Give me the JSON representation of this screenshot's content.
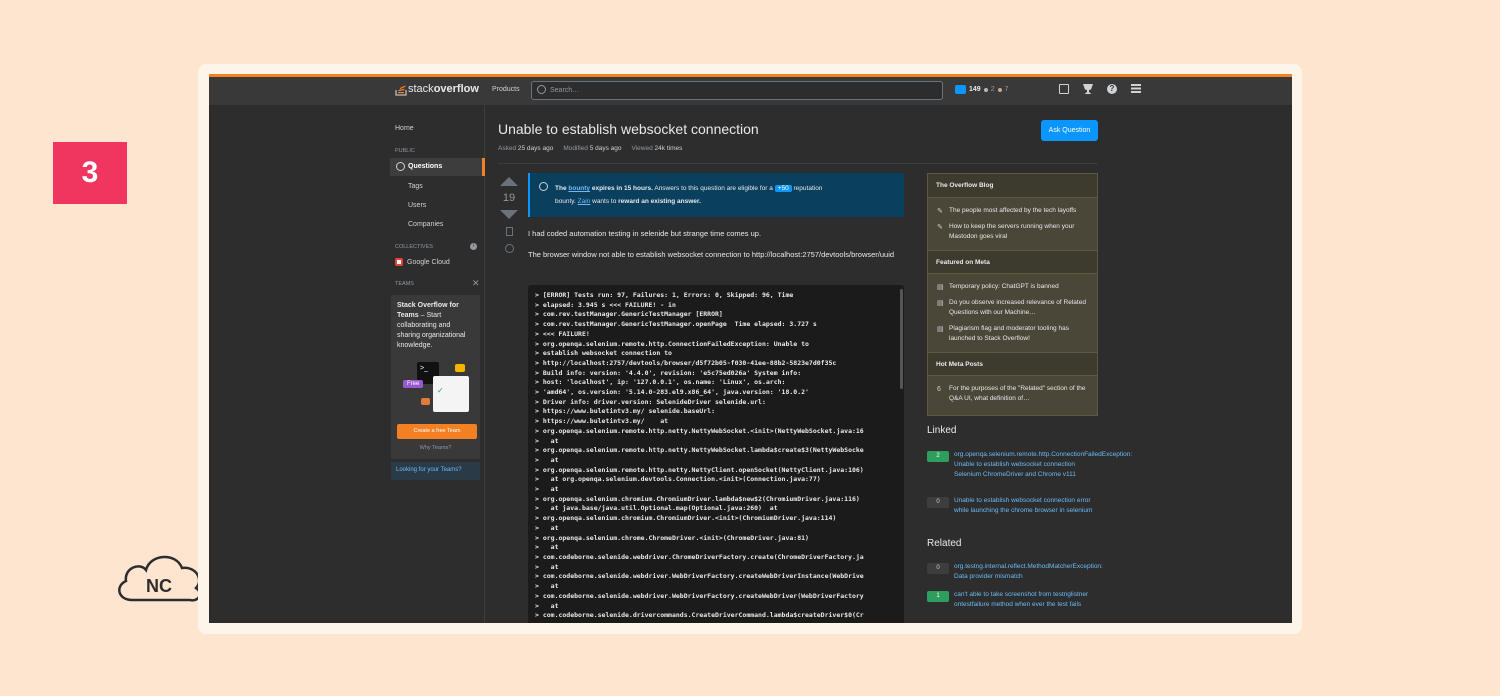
{
  "step_number": "3",
  "brand_logo_text": "NC",
  "colors": {
    "accent": "#f48024",
    "link": "#6cbbf7",
    "primary_button": "#0a95ff",
    "accepted_green": "#2e9e5e",
    "step_badge": "#f0355e"
  },
  "topbar": {
    "logo_light": "stack",
    "logo_bold": "overflow",
    "products": "Products",
    "search_placeholder": "Search…",
    "reputation": "149",
    "silver": "2",
    "bronze": "7",
    "icons": [
      "inbox-icon",
      "trophy-icon",
      "help-icon",
      "stackexchange-icon"
    ]
  },
  "sidebar": {
    "home": "Home",
    "public": "PUBLIC",
    "questions": "Questions",
    "tags": "Tags",
    "users": "Users",
    "companies": "Companies",
    "collectives": "COLLECTIVES",
    "google_cloud": "Google Cloud",
    "teams": "TEAMS",
    "card_title_bold": "Stack Overflow for Teams",
    "card_title_rest": " – Start collaborating and sharing organizational knowledge.",
    "illus_free": "Free",
    "create_team": "Create a free Team",
    "why_teams": "Why Teams?",
    "looking": "Looking for your Teams?"
  },
  "question": {
    "title": "Unable to establish websocket connection",
    "asked_label": "Asked",
    "asked": "25 days ago",
    "modified_label": "Modified",
    "modified": "5 days ago",
    "viewed_label": "Viewed",
    "viewed": "24k times",
    "ask_button": "Ask Question",
    "votes": "19",
    "bounty_pre": "The ",
    "bounty_link": "bounty",
    "bounty_mid": " expires in 15 hours.",
    "bounty_rest": " Answers to this question are eligible for a ",
    "bounty_amount": "+50",
    "bounty_rep": " reputation",
    "bounty_line2_pre": "bounty. ",
    "bounty_user": "Zain",
    "bounty_line2_mid": " wants to ",
    "bounty_reward": "reward an existing answer.",
    "para1": "I had coded automation testing in selenide but strange time comes up.",
    "para2": "The browser window not able to establish websocket connection to http://localhost:2757/devtools/browser/uuid"
  },
  "code_lines": [
    "> [ERROR] Tests run: 97, Failures: 1, Errors: 0, Skipped: 96, Time",
    "elapsed: 3.945 s <<< FAILURE! - in",
    "com.rev.testManager.GenericTestManager [ERROR]",
    "com.rev.testManager.GenericTestManager.openPage  Time elapsed: 3.727 s",
    "<<< FAILURE!",
    "org.openqa.selenium.remote.http.ConnectionFailedException: Unable to",
    "establish websocket connection to",
    "http://localhost:2757/devtools/browser/d5f72b05-f030-41ee-88b2-5823e7d0f35c",
    "Build info: version: '4.4.0', revision: 'e5c75ed026a' System info:",
    "host: 'localhost', ip: '127.0.0.1', os.name: 'Linux', os.arch:",
    "'amd64', os.version: '5.14.0-283.el9.x86_64', java.version: '18.0.2'",
    "Driver info: driver.version: SelenideDriver selenide.url:",
    "https://www.buletintv3.my/ selenide.baseUrl:",
    "https://www.buletintv3.my/    at",
    "org.openqa.selenium.remote.http.netty.NettyWebSocket.<init>(NettyWebSocket.java:16",
    ">   at",
    "org.openqa.selenium.remote.http.netty.NettyWebSocket.lambda$create$3(NettyWebSocke",
    ">   at",
    "org.openqa.selenium.remote.http.netty.NettyClient.openSocket(NettyClient.java:106)",
    ">   at org.openqa.selenium.devtools.Connection.<init>(Connection.java:77)",
    ">   at",
    "org.openqa.selenium.chromium.ChromiumDriver.lambda$new$2(ChromiumDriver.java:116)",
    ">   at java.base/java.util.Optional.map(Optional.java:260)  at",
    "org.openqa.selenium.chromium.ChromiumDriver.<init>(ChromiumDriver.java:114)",
    ">   at",
    "org.openqa.selenium.chrome.ChromeDriver.<init>(ChromeDriver.java:81)",
    ">   at",
    "com.codeborne.selenide.webdriver.ChromeDriverFactory.create(ChromeDriverFactory.ja",
    ">   at",
    "com.codeborne.selenide.webdriver.WebDriverFactory.createWebDriverInstance(WebDrive",
    ">   at",
    "com.codeborne.selenide.webdriver.WebDriverFactory.createWebDriver(WebDriverFactory",
    ">   at",
    "com.codeborne.selenide.drivercommands.CreateDriverCommand.lambda$createDriver$0(Cr"
  ],
  "blog": {
    "overflow_blog": "The Overflow Blog",
    "blog_items": [
      "The people most affected by the tech layoffs",
      "How to keep the servers running when your Mastodon goes viral"
    ],
    "featured_meta": "Featured on Meta",
    "meta_items": [
      "Temporary policy: ChatGPT is banned",
      "Do you observe increased relevance of Related Questions with our Machine…",
      "Plagiarism flag and moderator tooling has launched to Stack Overflow!"
    ],
    "hot_meta": "Hot Meta Posts",
    "hot_count": "6",
    "hot_item": "For the purposes of the \"Related\" section of the Q&A UI, what definition of…"
  },
  "linked": {
    "title": "Linked",
    "items": [
      {
        "count": "2",
        "text": "org.openqa.selenium.remote.http.ConnectionFailedException: Unable to establish websocket connection Selenium ChromeDriver and Chrome v111"
      },
      {
        "count": "0",
        "text": "Unable to establish websocket connection error while launching the chrome browser in selenium"
      }
    ]
  },
  "related": {
    "title": "Related",
    "items": [
      {
        "count": "0",
        "text": "org.testng.internal.reflect.MethodMatcherException: Data provider mismatch"
      },
      {
        "count": "1",
        "text": "can't able to take screenshot from testnglistner ontestfailure method when ever the test fails"
      }
    ]
  }
}
